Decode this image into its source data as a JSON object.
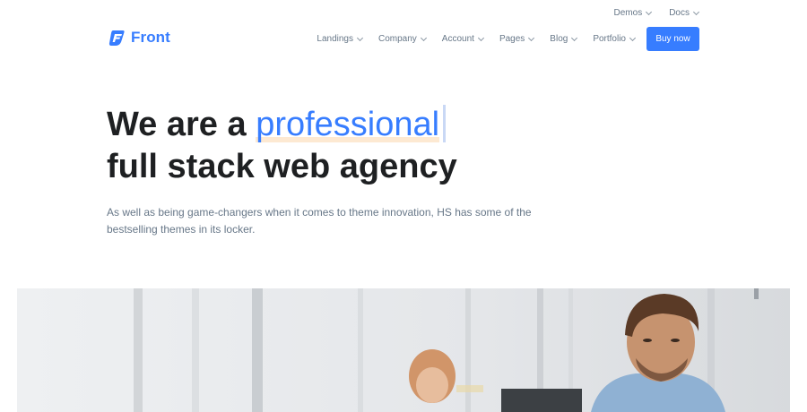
{
  "topbar": {
    "items": [
      {
        "label": "Demos"
      },
      {
        "label": "Docs"
      }
    ]
  },
  "brand": {
    "name": "Front",
    "logo_letter": "F",
    "color": "#377dff"
  },
  "nav": {
    "items": [
      {
        "label": "Landings"
      },
      {
        "label": "Company"
      },
      {
        "label": "Account"
      },
      {
        "label": "Pages"
      },
      {
        "label": "Blog"
      },
      {
        "label": "Portfolio"
      }
    ],
    "cta_label": "Buy now"
  },
  "hero": {
    "headline_prefix": "We are a",
    "headline_highlight": "professional",
    "headline_line2": "full stack web agency",
    "subtitle": "As well as being game-changers when it comes to theme innovation, HS has some of the bestselling themes in its locker."
  },
  "colors": {
    "primary": "#377dff",
    "text_dark": "#1e2022",
    "text_muted": "#677788",
    "highlight_underline": "#fde9d2"
  },
  "icons": {
    "dropdown": "chevron-down-icon",
    "logo": "front-logo-icon"
  }
}
